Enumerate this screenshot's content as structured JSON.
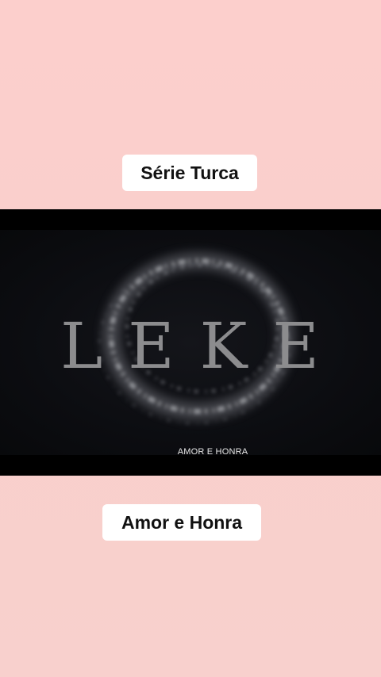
{
  "captions": {
    "top": "Série Turca",
    "bottom": "Amor e Honra"
  },
  "video": {
    "title": "LEKE",
    "subtitle": "AMOR E HONRA"
  },
  "colors": {
    "background": "#fccfcc",
    "caption_bg": "#ffffff",
    "video_bg": "#000000",
    "title_color": "#8c8c8e"
  }
}
